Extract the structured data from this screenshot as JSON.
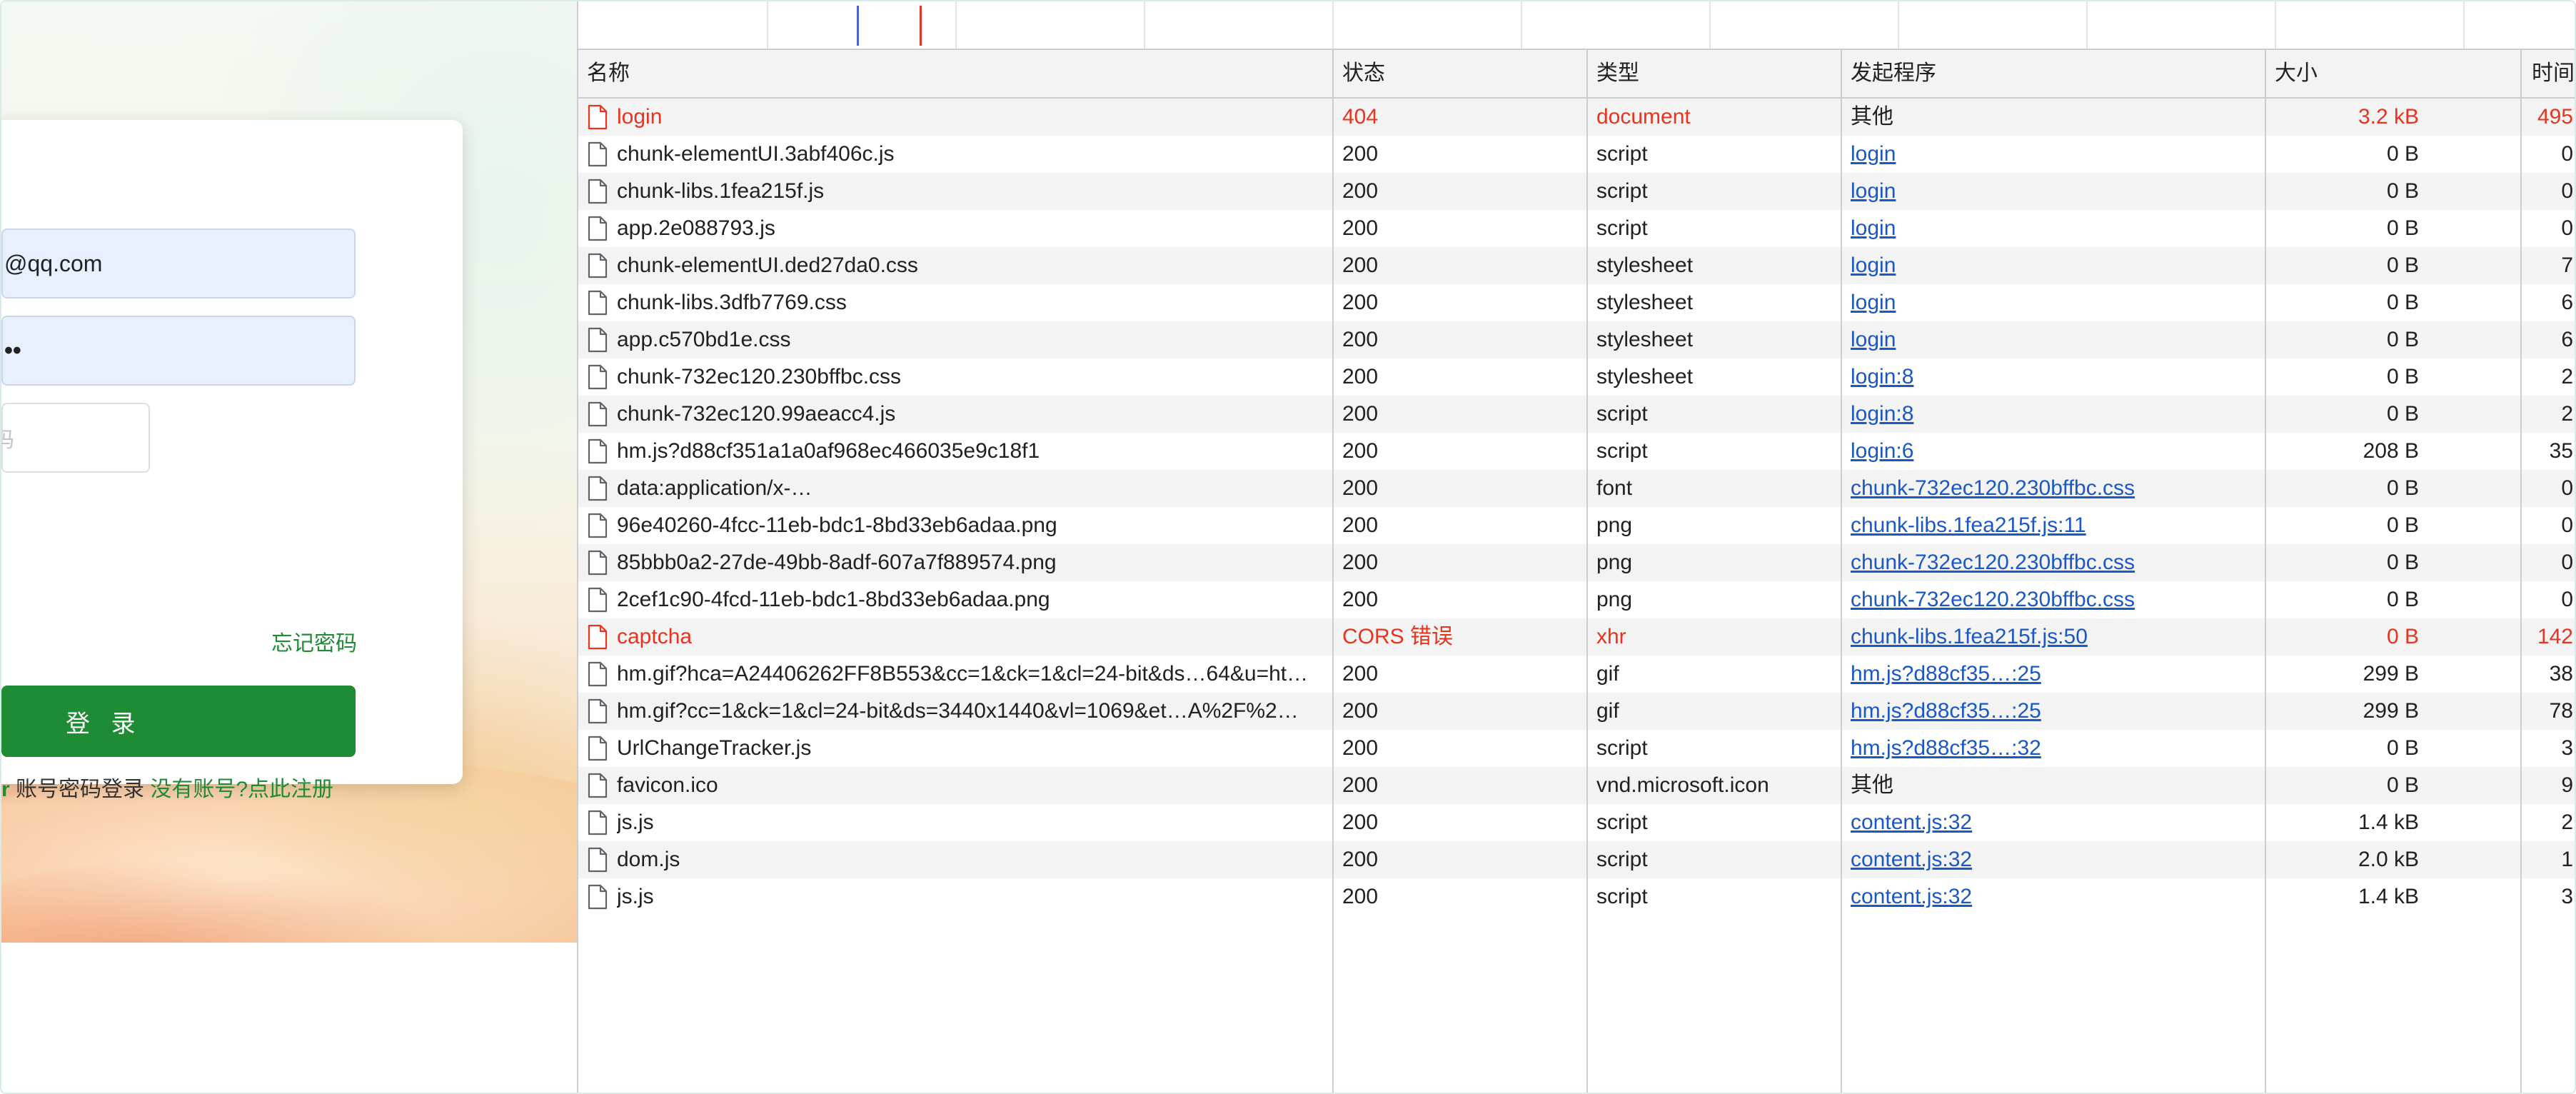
{
  "login_form": {
    "email_value": "@qq.com",
    "password_value": "••",
    "captcha_placeholder": "码",
    "forgot_label": "忘记密码",
    "login_label": "登 录",
    "links_prefix": "r",
    "links_middle": " 账号密码登录 ",
    "register_label": "没有账号?点此注册"
  },
  "network": {
    "columns": {
      "name": "名称",
      "status": "状态",
      "type": "类型",
      "initiator": "发起程序",
      "size": "大小",
      "time": "时间"
    },
    "rows": [
      {
        "name": "login",
        "status": "404",
        "type": "document",
        "initiator": "其他",
        "initiator_link": false,
        "size": "3.2 kB",
        "time": "495",
        "error": true
      },
      {
        "name": "chunk-elementUI.3abf406c.js",
        "status": "200",
        "type": "script",
        "initiator": "login",
        "initiator_link": true,
        "size": "0 B",
        "time": "0",
        "error": false
      },
      {
        "name": "chunk-libs.1fea215f.js",
        "status": "200",
        "type": "script",
        "initiator": "login",
        "initiator_link": true,
        "size": "0 B",
        "time": "0",
        "error": false
      },
      {
        "name": "app.2e088793.js",
        "status": "200",
        "type": "script",
        "initiator": "login",
        "initiator_link": true,
        "size": "0 B",
        "time": "0",
        "error": false
      },
      {
        "name": "chunk-elementUI.ded27da0.css",
        "status": "200",
        "type": "stylesheet",
        "initiator": "login",
        "initiator_link": true,
        "size": "0 B",
        "time": "7",
        "error": false
      },
      {
        "name": "chunk-libs.3dfb7769.css",
        "status": "200",
        "type": "stylesheet",
        "initiator": "login",
        "initiator_link": true,
        "size": "0 B",
        "time": "6",
        "error": false
      },
      {
        "name": "app.c570bd1e.css",
        "status": "200",
        "type": "stylesheet",
        "initiator": "login",
        "initiator_link": true,
        "size": "0 B",
        "time": "6",
        "error": false
      },
      {
        "name": "chunk-732ec120.230bffbc.css",
        "status": "200",
        "type": "stylesheet",
        "initiator": "login:8",
        "initiator_link": true,
        "size": "0 B",
        "time": "2",
        "error": false
      },
      {
        "name": "chunk-732ec120.99aeacc4.js",
        "status": "200",
        "type": "script",
        "initiator": "login:8",
        "initiator_link": true,
        "size": "0 B",
        "time": "2",
        "error": false
      },
      {
        "name": "hm.js?d88cf351a1a0af968ec466035e9c18f1",
        "status": "200",
        "type": "script",
        "initiator": "login:6",
        "initiator_link": true,
        "size": "208 B",
        "time": "35",
        "error": false
      },
      {
        "name": "data:application/x-…",
        "status": "200",
        "type": "font",
        "initiator": "chunk-732ec120.230bffbc.css",
        "initiator_link": true,
        "size": "0 B",
        "time": "0",
        "error": false
      },
      {
        "name": "96e40260-4fcc-11eb-bdc1-8bd33eb6adaa.png",
        "status": "200",
        "type": "png",
        "initiator": "chunk-libs.1fea215f.js:11",
        "initiator_link": true,
        "size": "0 B",
        "time": "0",
        "error": false
      },
      {
        "name": "85bbb0a2-27de-49bb-8adf-607a7f889574.png",
        "status": "200",
        "type": "png",
        "initiator": "chunk-732ec120.230bffbc.css",
        "initiator_link": true,
        "size": "0 B",
        "time": "0",
        "error": false
      },
      {
        "name": "2cef1c90-4fcd-11eb-bdc1-8bd33eb6adaa.png",
        "status": "200",
        "type": "png",
        "initiator": "chunk-732ec120.230bffbc.css",
        "initiator_link": true,
        "size": "0 B",
        "time": "0",
        "error": false
      },
      {
        "name": "captcha",
        "status": "CORS 错误",
        "type": "xhr",
        "initiator": "chunk-libs.1fea215f.js:50",
        "initiator_link": true,
        "size": "0 B",
        "time": "142",
        "error": true
      },
      {
        "name": "hm.gif?hca=A24406262FF8B553&cc=1&ck=1&cl=24-bit&ds…64&u=ht…",
        "status": "200",
        "type": "gif",
        "initiator": "hm.js?d88cf35…:25",
        "initiator_link": true,
        "size": "299 B",
        "time": "38",
        "error": false
      },
      {
        "name": "hm.gif?cc=1&ck=1&cl=24-bit&ds=3440x1440&vl=1069&et…A%2F%2…",
        "status": "200",
        "type": "gif",
        "initiator": "hm.js?d88cf35…:25",
        "initiator_link": true,
        "size": "299 B",
        "time": "78",
        "error": false
      },
      {
        "name": "UrlChangeTracker.js",
        "status": "200",
        "type": "script",
        "initiator": "hm.js?d88cf35…:32",
        "initiator_link": true,
        "size": "0 B",
        "time": "3",
        "error": false
      },
      {
        "name": "favicon.ico",
        "status": "200",
        "type": "vnd.microsoft.icon",
        "initiator": "其他",
        "initiator_link": false,
        "size": "0 B",
        "time": "9",
        "error": false
      },
      {
        "name": "js.js",
        "status": "200",
        "type": "script",
        "initiator": "content.js:32",
        "initiator_link": true,
        "size": "1.4 kB",
        "time": "2",
        "error": false
      },
      {
        "name": "dom.js",
        "status": "200",
        "type": "script",
        "initiator": "content.js:32",
        "initiator_link": true,
        "size": "2.0 kB",
        "time": "1",
        "error": false
      },
      {
        "name": "js.js",
        "status": "200",
        "type": "script",
        "initiator": "content.js:32",
        "initiator_link": true,
        "size": "1.4 kB",
        "time": "3",
        "error": false
      }
    ]
  },
  "colors": {
    "error": "#e8331f",
    "link": "#1a57c7",
    "brand_green": "#1e8b35",
    "timeline_blue": "#4a5fd6",
    "timeline_red": "#e0322f"
  }
}
